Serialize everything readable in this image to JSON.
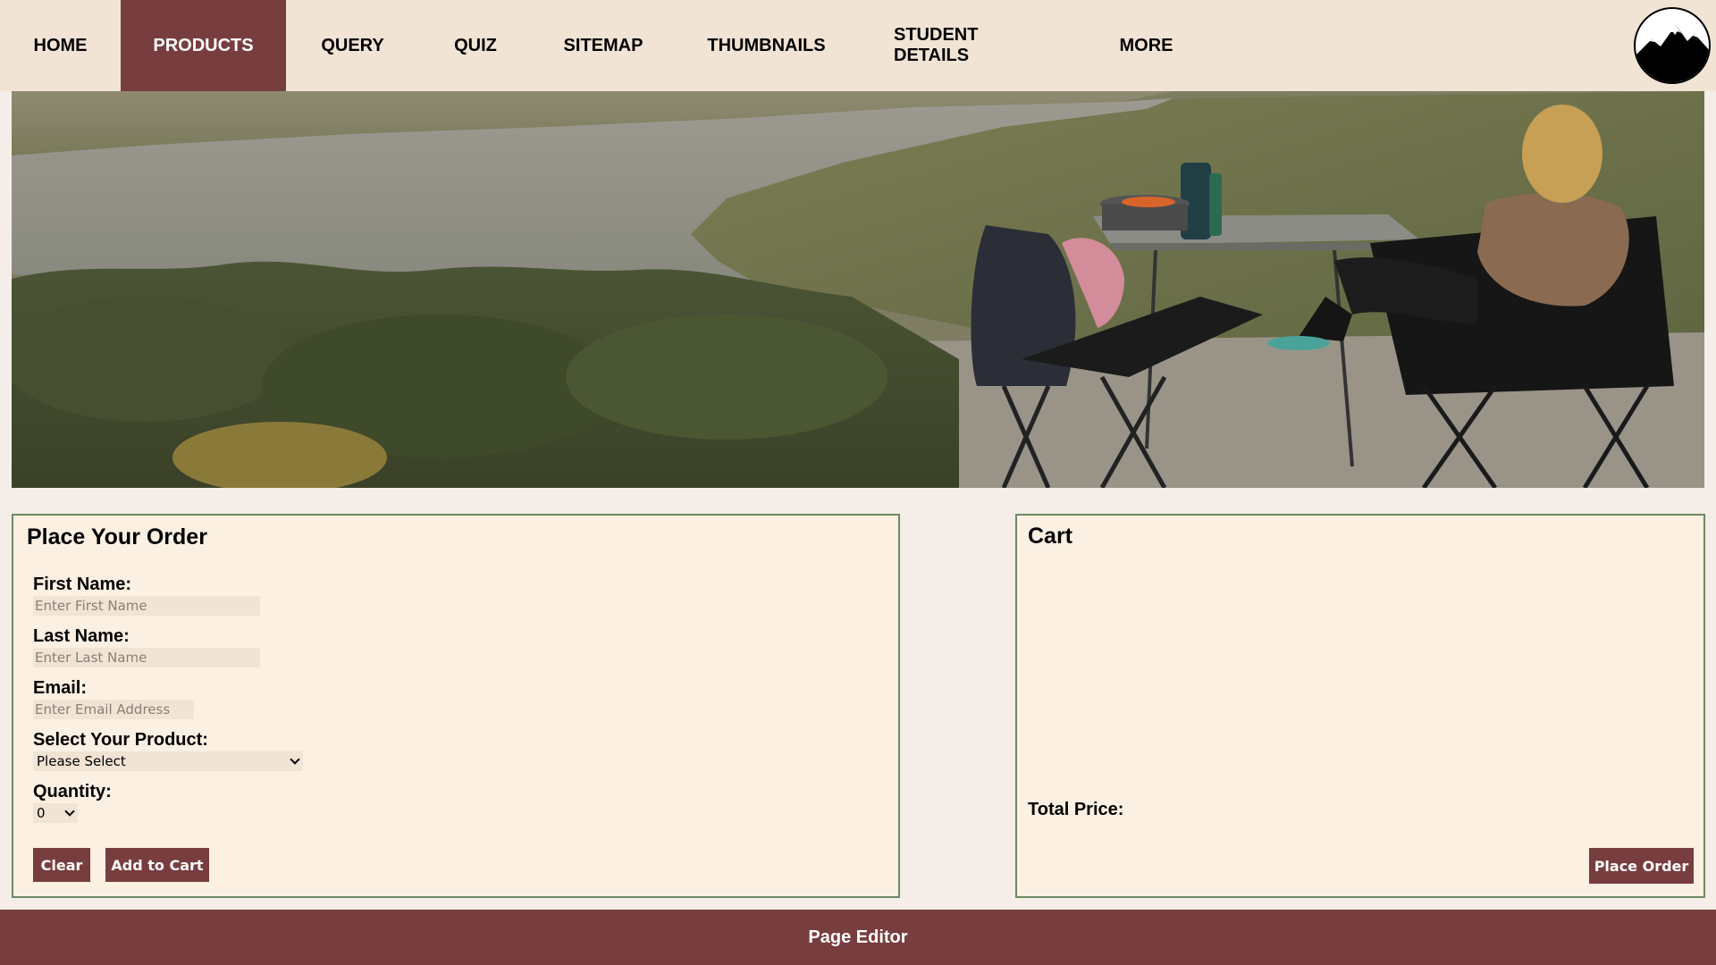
{
  "nav": {
    "items": [
      {
        "label": "HOME"
      },
      {
        "label": "PRODUCTS",
        "active": true
      },
      {
        "label": "QUERY"
      },
      {
        "label": "QUIZ"
      },
      {
        "label": "SITEMAP"
      },
      {
        "label": "THUMBNAILS"
      },
      {
        "label": "STUDENT DETAILS"
      },
      {
        "label": "MORE"
      }
    ],
    "logo_icon": "mountain-logo-icon"
  },
  "hero": {
    "image_icon": "hero-landscape-image"
  },
  "order": {
    "title": "Place Your Order",
    "first_name_label": "First Name:",
    "first_name_placeholder": "Enter First Name",
    "last_name_label": "Last Name:",
    "last_name_placeholder": "Enter Last Name",
    "email_label": "Email:",
    "email_placeholder": "Enter Email Address",
    "product_label": "Select Your Product:",
    "product_selected": "Please Select",
    "quantity_label": "Quantity:",
    "quantity_selected": "0",
    "clear_label": "Clear",
    "add_label": "Add to Cart"
  },
  "cart": {
    "title": "Cart",
    "total_label": "Total Price:",
    "place_order_label": "Place Order"
  },
  "footer": {
    "label": "Page Editor"
  },
  "colors": {
    "accent": "#783d3e",
    "nav_bg": "#f2e4d5",
    "panel_bg": "#fcf0e2",
    "panel_border": "#6d8a64",
    "page_bg": "#f5ede7"
  }
}
